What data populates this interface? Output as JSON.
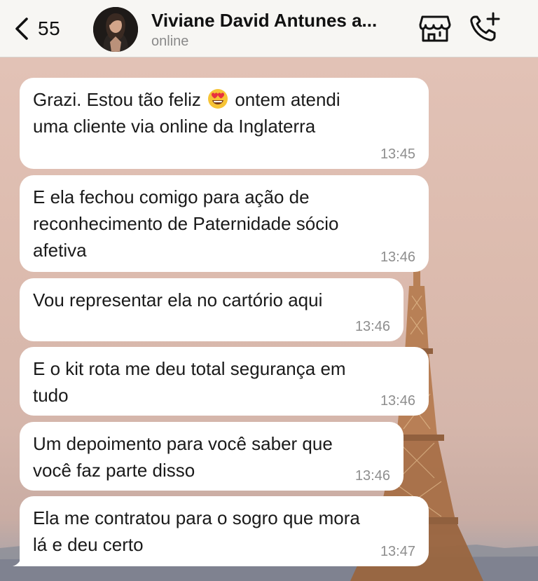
{
  "header": {
    "back_count": "55",
    "contact_name": "Viviane David Antunes a...",
    "status": "online",
    "icons": {
      "back": "chevron-left-icon",
      "avatar": "avatar",
      "store": "storefront-icon",
      "call": "phone-add-icon"
    }
  },
  "messages": [
    {
      "before": "Grazi. Estou tão feliz ",
      "emoji": "heart-eyes-emoji",
      "after": " ontem atendi\numa cliente via online da Inglaterra",
      "time": "13:45"
    },
    {
      "text": "E ela fechou comigo para ação de\nreconhecimento de Paternidade sócio\nafetiva",
      "time": "13:46"
    },
    {
      "text": "Vou representar ela no cartório aqui",
      "time": "13:46"
    },
    {
      "text": "E o kit rota me deu total segurança em\ntudo",
      "time": "13:46"
    },
    {
      "text": "Um depoimento para você saber que\nvocê faz parte disso",
      "time": "13:46"
    },
    {
      "text": "Ela me contratou para o sogro que mora\nlá e deu certo",
      "time": "13:47"
    }
  ],
  "colors": {
    "bubble": "#ffffff",
    "header_bg": "#f7f6f3",
    "timestamp": "#8e8e8e",
    "status": "#8a8a8a"
  }
}
